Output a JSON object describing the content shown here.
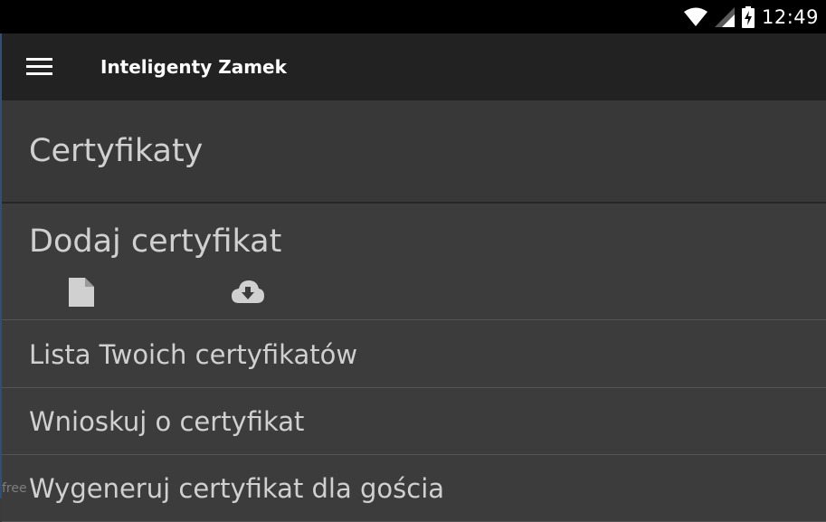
{
  "status_bar": {
    "time": "12:49"
  },
  "app_bar": {
    "title": "Inteligenty Zamek"
  },
  "page": {
    "heading": "Certyfikaty"
  },
  "add_section": {
    "title": "Dodaj certyfikat",
    "icons": [
      "file-icon",
      "cloud-download-icon"
    ]
  },
  "menu": {
    "items": [
      {
        "label": "Lista Twoich certyfikatów"
      },
      {
        "label": "Wnioskuj o certyfikat"
      },
      {
        "label": "Wygeneruj certyfikat dla gościa"
      }
    ]
  },
  "watermark": "free"
}
